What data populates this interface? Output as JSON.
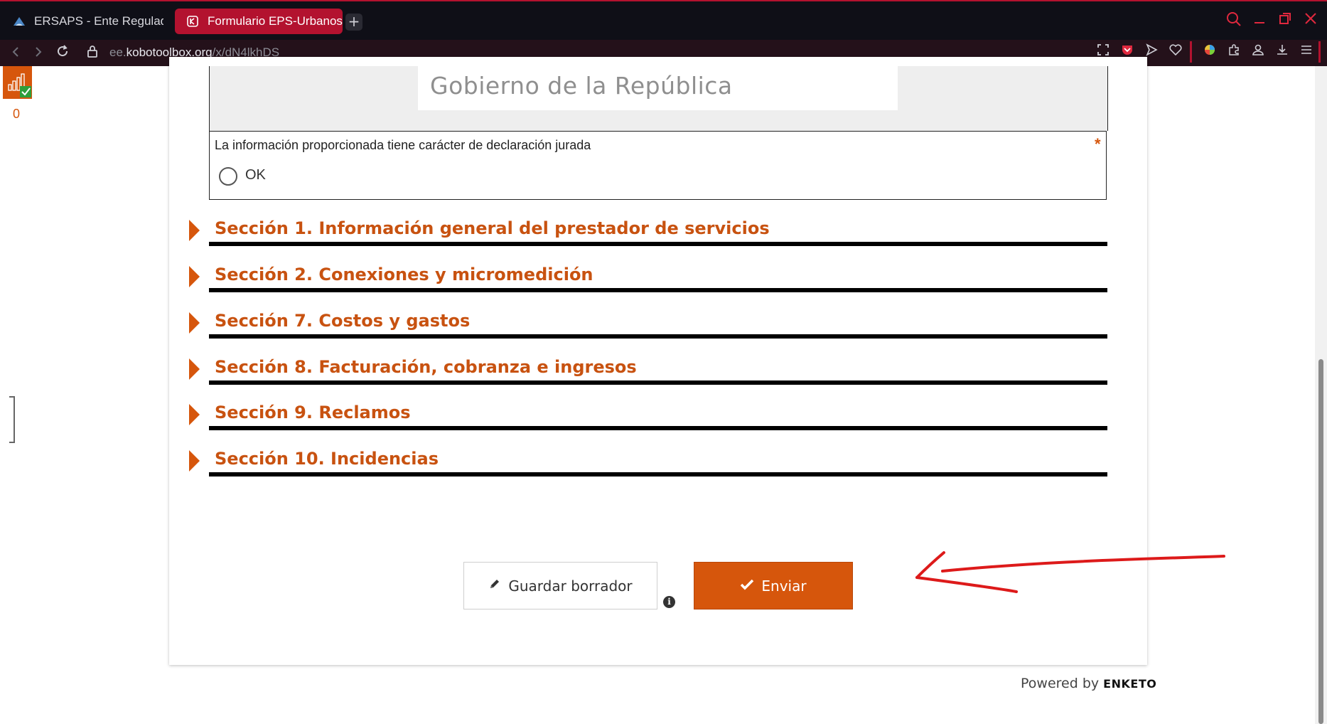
{
  "browser": {
    "tabs": [
      {
        "label": "ERSAPS - Ente Regulador",
        "active": false,
        "icon": "ersaps-favicon"
      },
      {
        "label": "Formulario EPS-Urbanos",
        "active": true,
        "icon": "kobo-favicon"
      }
    ],
    "url": {
      "prefix": "ee.",
      "host": "kobotoolbox.org",
      "path": "/x/dN4lkhDS"
    },
    "accent_color": "#b3122f"
  },
  "sidebar": {
    "queue_count": "0"
  },
  "form": {
    "logo_text": "Gobierno de la República",
    "question": {
      "label": "La información proporcionada tiene carácter de declaración jurada",
      "required_mark": "*",
      "option": "OK"
    },
    "sections": [
      "Sección 1. Información general del prestador de servicios",
      "Sección 2. Conexiones y micromedición",
      "Sección 7. Costos y gastos",
      "Sección 8. Facturación, cobranza e ingresos",
      "Sección 9. Reclamos",
      "Sección 10. Incidencias"
    ],
    "accent_color": "#d6560c"
  },
  "actions": {
    "draft_label": "Guardar borrador",
    "send_label": "Enviar"
  },
  "footer": {
    "powered_prefix": "Powered by",
    "brand": "ENKETO"
  }
}
